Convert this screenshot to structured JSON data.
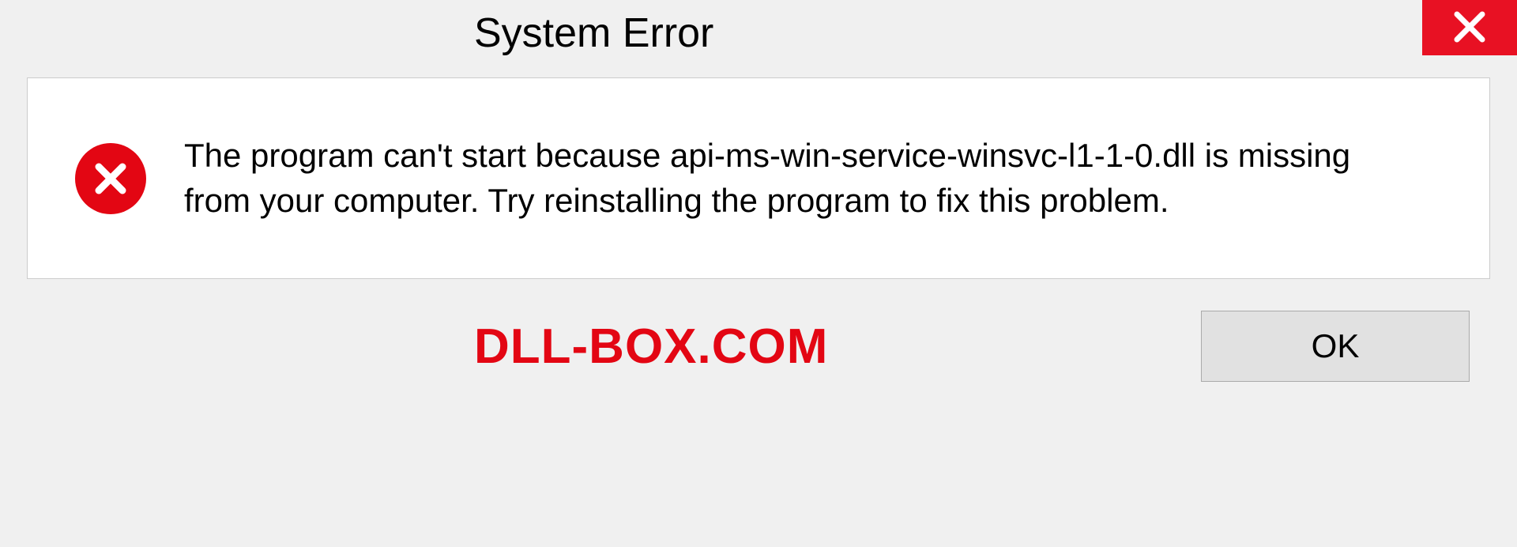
{
  "titlebar": {
    "title": "System Error"
  },
  "body": {
    "message": "The program can't start because api-ms-win-service-winsvc-l1-1-0.dll is missing from your computer. Try reinstalling the program to fix this problem."
  },
  "footer": {
    "watermark": "DLL-BOX.COM",
    "ok_label": "OK"
  }
}
